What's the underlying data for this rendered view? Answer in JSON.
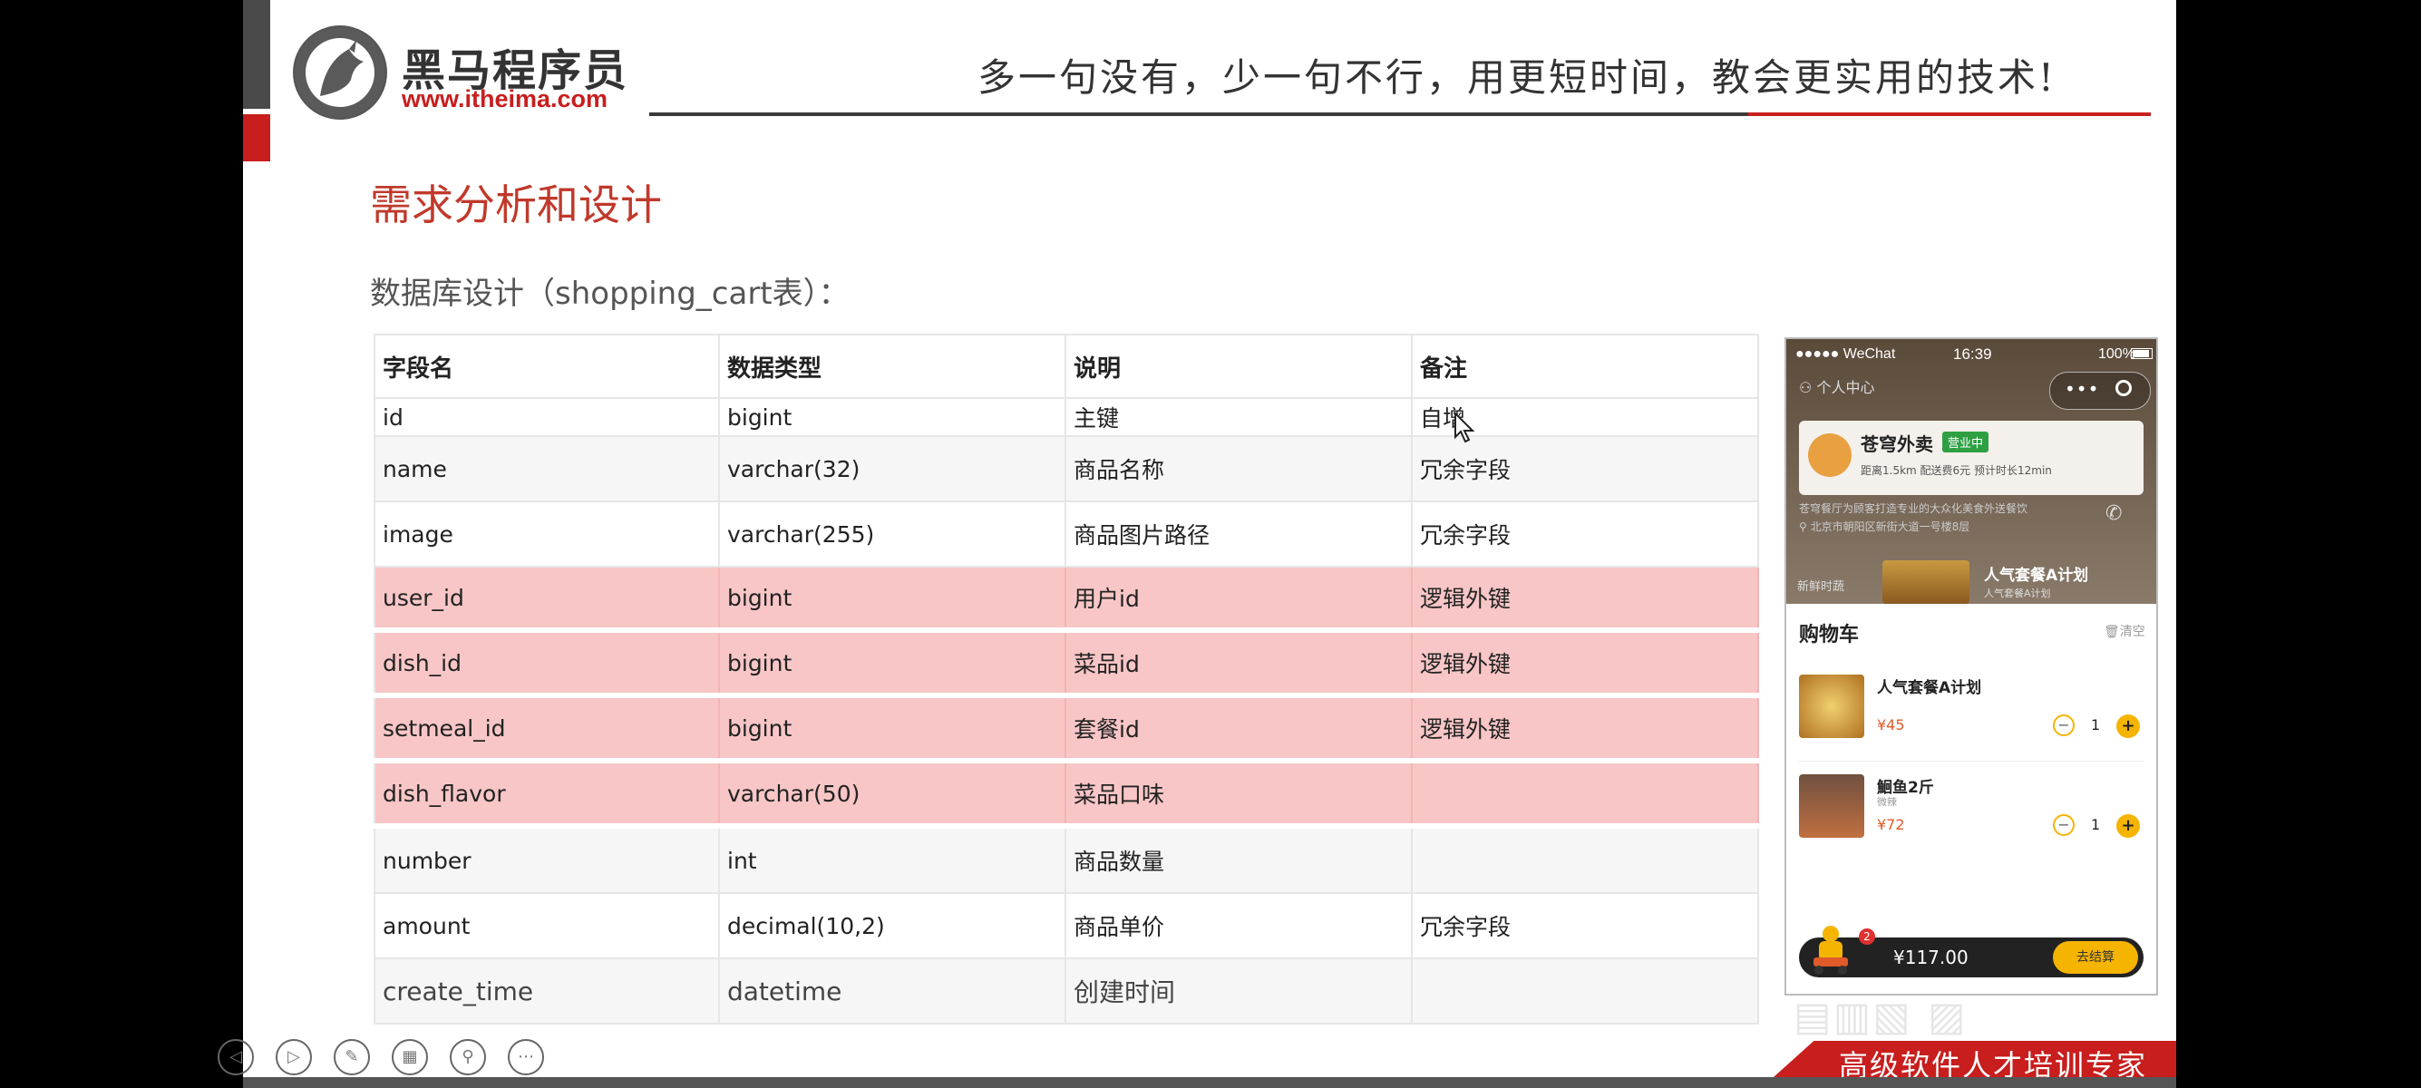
{
  "header": {
    "logo_name": "黑马程序员",
    "logo_url": "www.itheima.com",
    "slogan": "多一句没有，少一句不行，用更短时间，教会更实用的技术!"
  },
  "slide": {
    "title": "需求分析和设计",
    "subtitle": "数据库设计（shopping_cart表）："
  },
  "table": {
    "headers": [
      "字段名",
      "数据类型",
      "说明",
      "备注"
    ],
    "rows": [
      [
        "id",
        "bigint",
        "主键",
        "自增"
      ],
      [
        "name",
        "varchar(32)",
        "商品名称",
        "冗余字段"
      ],
      [
        "image",
        "varchar(255)",
        "商品图片路径",
        "冗余字段"
      ],
      [
        "user_id",
        "bigint",
        "用户id",
        "逻辑外键"
      ],
      [
        "dish_id",
        "bigint",
        "菜品id",
        "逻辑外键"
      ],
      [
        "setmeal_id",
        "bigint",
        "套餐id",
        "逻辑外键"
      ],
      [
        "dish_flavor",
        "varchar(50)",
        "菜品口味",
        ""
      ],
      [
        "number",
        "int",
        "商品数量",
        ""
      ],
      [
        "amount",
        "decimal(10,2)",
        "商品单价",
        "冗余字段"
      ],
      [
        "create_time",
        "datetime",
        "创建时间",
        ""
      ]
    ]
  },
  "phone": {
    "status_left": "●●●●● WeChat",
    "status_time": "16:39",
    "status_right": "100%",
    "personal_center": "个人中心",
    "capsule_dots": "•••",
    "shop_name": "苍穹外卖",
    "shop_badge": "营业中",
    "shop_meta": "距离1.5km  配送费6元  预计时长12min",
    "shop_desc": "苍穹餐厅为顾客打造专业的大众化美食外送餐饮",
    "shop_address": "北京市朝阳区新街大道一号楼8层",
    "category_label": "新鲜时蔬",
    "promo_name": "人气套餐A计划",
    "promo_sub": "人气套餐A计划",
    "cart_title": "购物车",
    "cart_clear": "清空",
    "items": [
      {
        "name": "人气套餐A计划",
        "note": "",
        "price": "¥45",
        "qty": "1"
      },
      {
        "name": "鮰鱼2斤",
        "note": "微辣",
        "price": "¥72",
        "qty": "1"
      }
    ],
    "badge_count": "2",
    "total": "¥117.00",
    "checkout_label": "去结算"
  },
  "footer": {
    "banner": "高级软件人才培训专家"
  },
  "colors": {
    "accent_red": "#c81e1e",
    "highlight_row": "#f8c6c6",
    "button_yellow": "#f5b400"
  }
}
